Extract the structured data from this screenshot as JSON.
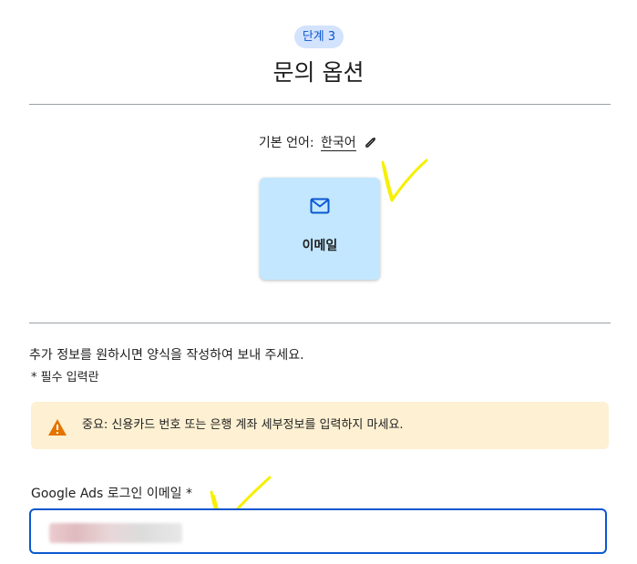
{
  "step": {
    "label": "단계 3"
  },
  "page": {
    "title": "문의 옵션"
  },
  "language": {
    "prefix": "기본 언어:",
    "value": "한국어"
  },
  "contact_options": [
    {
      "label": "이메일",
      "icon": "mail-icon"
    }
  ],
  "form": {
    "info_text": "추가 정보를 원하시면 양식을 작성하여 보내 주세요.",
    "required_note": "* 필수 입력란",
    "warning": {
      "icon": "warning-icon",
      "text": "중요: 신용카드 번호 또는 은행 계좌 세부정보를 입력하지 마세요."
    },
    "email_field": {
      "label": "Google Ads 로그인 이메일 *"
    }
  },
  "colors": {
    "accent": "#0b57d0",
    "badge_bg": "#d3e3fd",
    "card_bg": "#c2e7ff",
    "warning_bg": "#fef0d2",
    "warning_icon": "#e37400",
    "annotation": "#f6f000"
  }
}
